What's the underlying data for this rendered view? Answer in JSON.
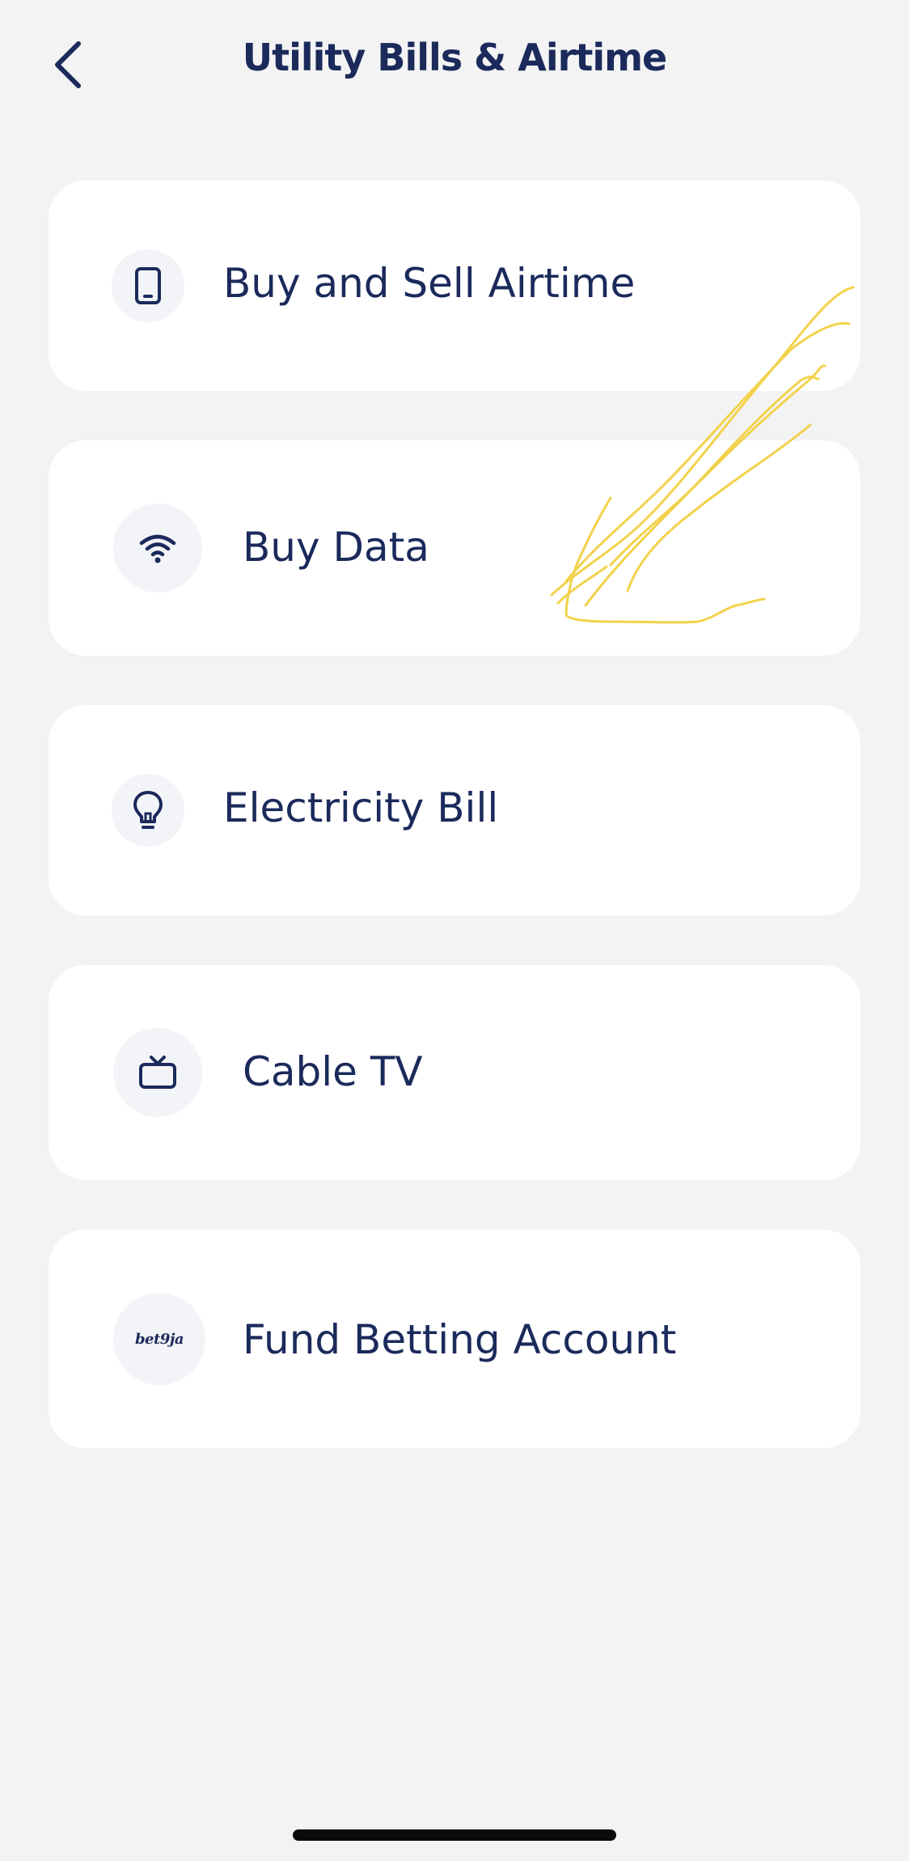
{
  "header": {
    "title": "Utility Bills & Airtime",
    "back_icon": "chevron-left-icon"
  },
  "services": [
    {
      "label": "Buy and Sell Airtime",
      "icon": "phone-icon"
    },
    {
      "label": "Buy Data",
      "icon": "wifi-icon"
    },
    {
      "label": "Electricity Bill",
      "icon": "lightbulb-icon"
    },
    {
      "label": "Cable TV",
      "icon": "tv-icon"
    },
    {
      "label": "Fund Betting Account",
      "icon": "bet9ja-logo",
      "logo_text": "bet9ja"
    }
  ],
  "colors": {
    "background": "#f3f3f4",
    "card": "#ffffff",
    "text": "#1b2a5b",
    "icon_bg": "#f3f4f7",
    "annotation": "#f2d24b"
  }
}
